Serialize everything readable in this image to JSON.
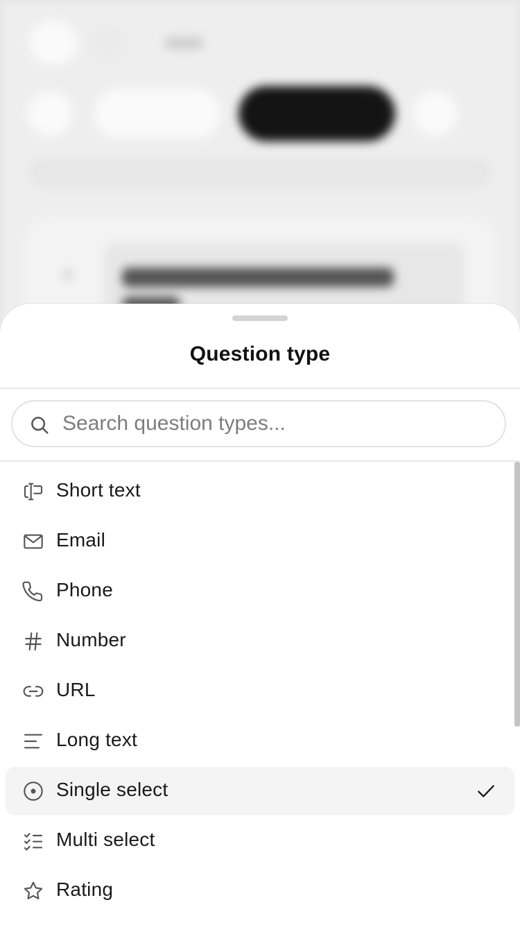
{
  "sheet": {
    "title": "Question type",
    "search": {
      "placeholder": "Search question types...",
      "value": "",
      "icon": "search-icon"
    },
    "items": [
      {
        "label": "Short text",
        "icon": "text-cursor-icon",
        "selected": false
      },
      {
        "label": "Email",
        "icon": "mail-icon",
        "selected": false
      },
      {
        "label": "Phone",
        "icon": "phone-icon",
        "selected": false
      },
      {
        "label": "Number",
        "icon": "hash-icon",
        "selected": false
      },
      {
        "label": "URL",
        "icon": "link-icon",
        "selected": false
      },
      {
        "label": "Long text",
        "icon": "align-left-icon",
        "selected": false
      },
      {
        "label": "Single select",
        "icon": "radio-circle-icon",
        "selected": true
      },
      {
        "label": "Multi select",
        "icon": "list-check-icon",
        "selected": false
      },
      {
        "label": "Rating",
        "icon": "star-icon",
        "selected": false
      }
    ],
    "selected_indicator_icon": "check-icon"
  },
  "colors": {
    "text": "#1a1a1a",
    "icon": "#555555",
    "selected_background": "#f4f4f4",
    "placeholder": "#7d7d7d"
  }
}
